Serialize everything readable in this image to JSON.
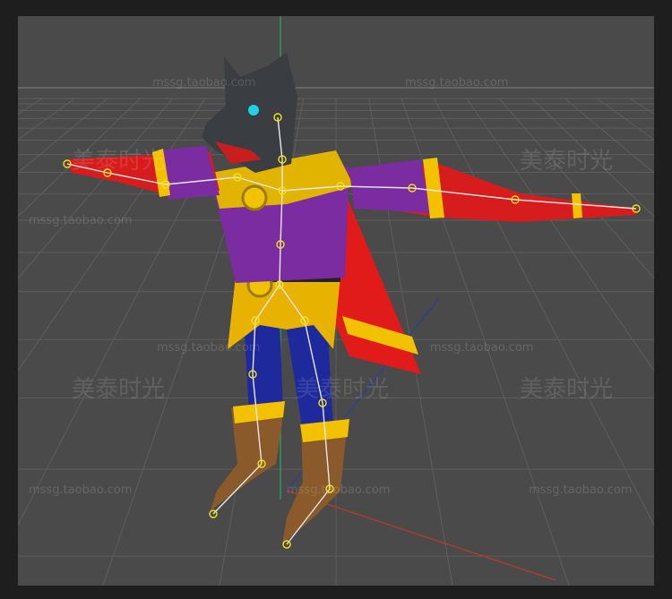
{
  "viewport": {
    "background": "#4a4a4a",
    "grid_color": "#5c5c5c",
    "horizon_color": "#7a7a7a",
    "axis_colors": {
      "x": "#c0392b",
      "y": "#27ae60",
      "z": "#2c3e9b"
    }
  },
  "watermarks": {
    "url": "mssg.taobao.com",
    "brand_cn": "美泰时光"
  },
  "character": {
    "description_icon": "wolf-warrior-tpose-model",
    "colors": {
      "head": "#3a3d42",
      "eye": "#1ed2e6",
      "tunic": "#7b2ca0",
      "gold": "#f2c100",
      "arms": "#d61c1c",
      "cape": "#e11a1a",
      "pants": "#1e2a9c",
      "boots": "#8a5a2b",
      "skeleton": "#e8e8e8",
      "joint": "#f5e400"
    }
  }
}
